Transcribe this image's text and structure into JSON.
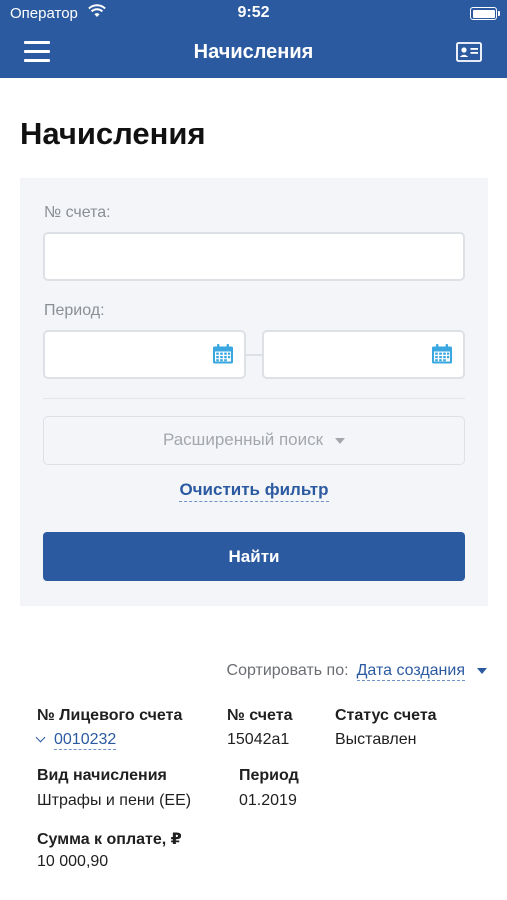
{
  "status_bar": {
    "carrier": "Оператор",
    "time": "9:52"
  },
  "navbar": {
    "title": "Начисления"
  },
  "page": {
    "title": "Начисления"
  },
  "filter": {
    "account_label": "№ счета:",
    "account_value": "",
    "period_label": "Период:",
    "period_from": "",
    "period_to": "",
    "advanced_search": "Расширенный поиск",
    "clear_filter": "Очистить фильтр",
    "find_button": "Найти"
  },
  "sort": {
    "label": "Сортировать по:",
    "value": "Дата создания"
  },
  "result": {
    "personal_account_header": "№ Лицевого счета",
    "personal_account_value": "0010232",
    "invoice_header": "№ счета",
    "invoice_value": "15042а1",
    "status_header": "Статус счета",
    "status_value": "Выставлен",
    "charge_type_header": "Вид начисления",
    "charge_type_value": "Штрафы и пени (ЕЕ)",
    "period_header": "Период",
    "period_value": "01.2019",
    "amount_header": "Сумма к оплате, ₽",
    "amount_value": "10 000,90"
  },
  "colors": {
    "primary": "#2c5aa0",
    "calendar_icon": "#3aa7e0",
    "filter_bg": "#f3f5f8"
  },
  "icons": [
    "wifi-icon",
    "battery-icon",
    "menu-icon",
    "id-card-icon",
    "calendar-icon",
    "caret-down-icon",
    "chevron-down-icon"
  ]
}
